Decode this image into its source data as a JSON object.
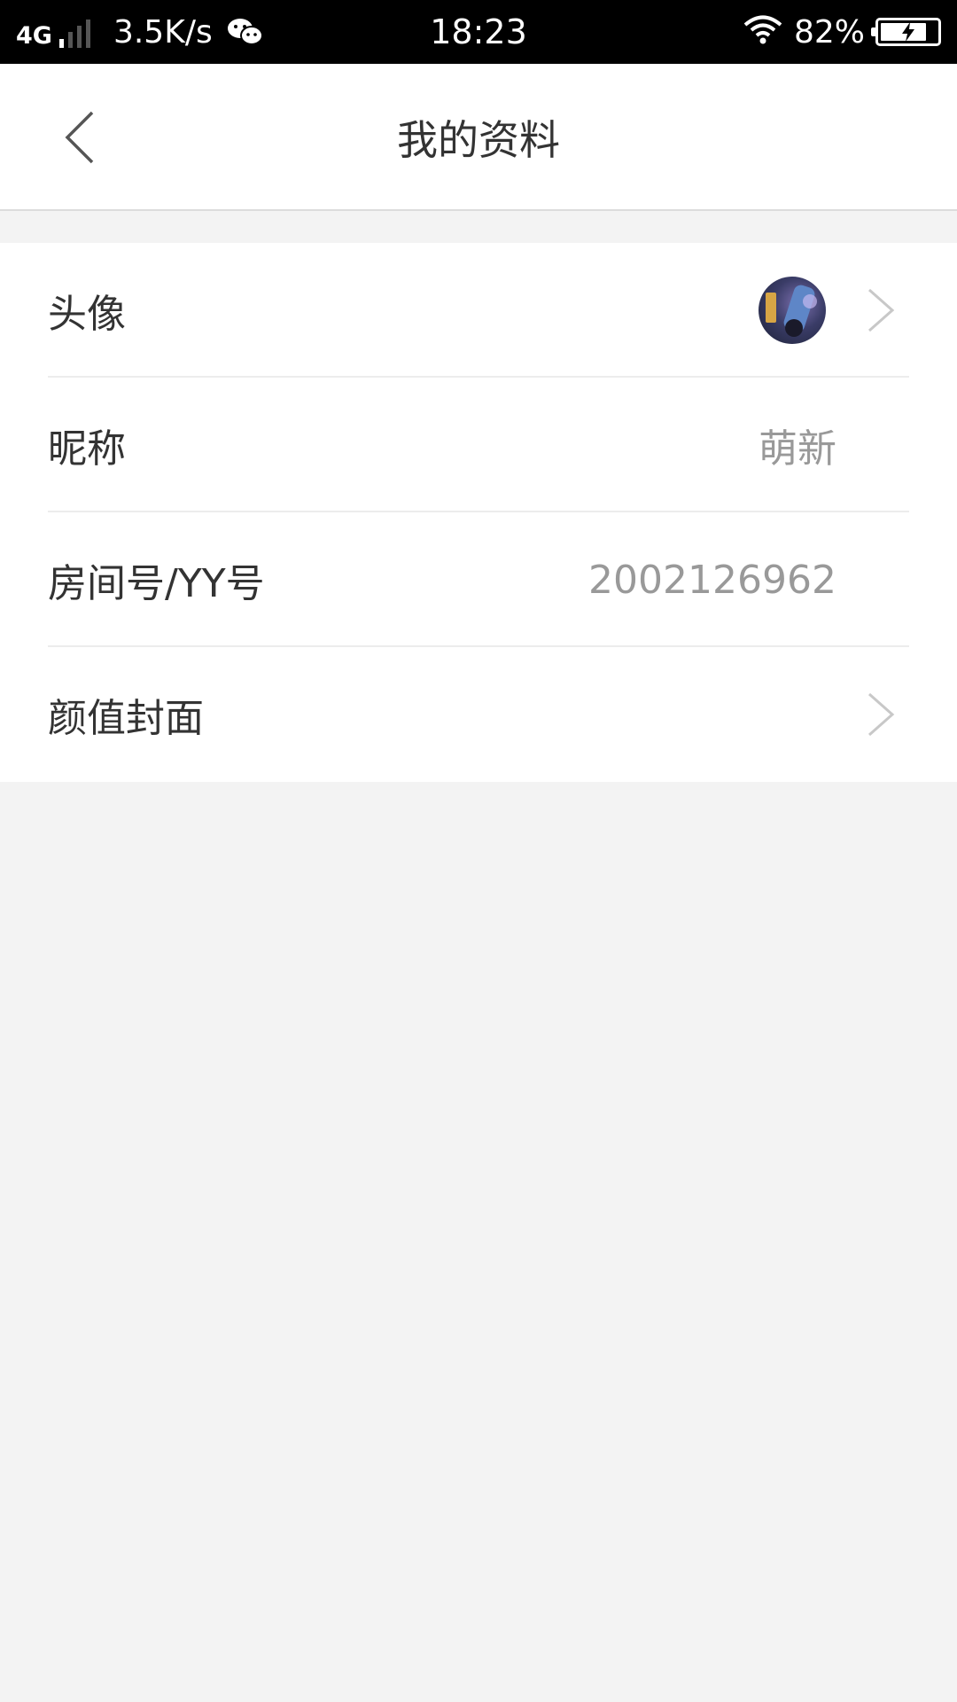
{
  "status_bar": {
    "network": "4G",
    "speed": "3.5K/s",
    "time": "18:23",
    "battery_percent": "82%",
    "battery_level": 0.82,
    "icons": [
      "signal-icon",
      "wechat-icon",
      "wifi-icon",
      "battery-charging-icon"
    ]
  },
  "header": {
    "title": "我的资料",
    "back_icon": "chevron-left-icon"
  },
  "rows": [
    {
      "label": "头像",
      "value": "",
      "has_avatar": true,
      "has_chevron": true
    },
    {
      "label": "昵称",
      "value": "萌新",
      "has_avatar": false,
      "has_chevron": false
    },
    {
      "label": "房间号/YY号",
      "value": "2002126962",
      "has_avatar": false,
      "has_chevron": false
    },
    {
      "label": "颜值封面",
      "value": "",
      "has_avatar": false,
      "has_chevron": true
    }
  ],
  "colors": {
    "background": "#f3f3f3",
    "card": "#ffffff",
    "label_text": "#333333",
    "value_text": "#999999",
    "chevron": "#c8c8c8"
  }
}
